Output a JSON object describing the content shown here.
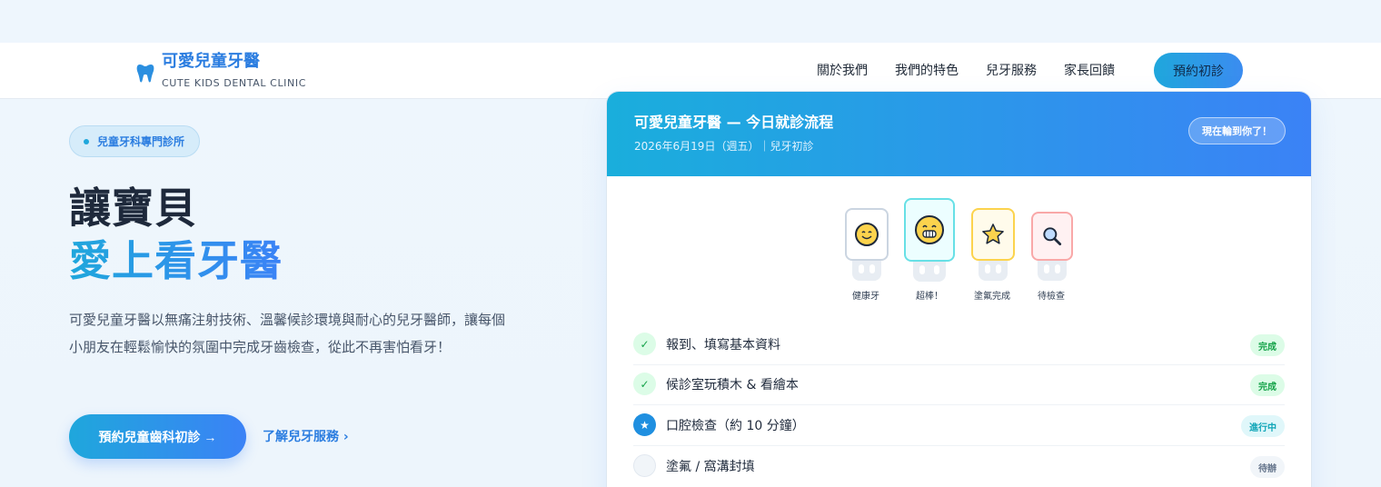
{
  "brand": {
    "title": "可愛兒童牙醫",
    "subtitle": "CUTE KIDS DENTAL CLINIC"
  },
  "nav": {
    "items": [
      "關於我們",
      "我們的特色",
      "兒牙服務",
      "家長回饋"
    ],
    "cta": "預約初診"
  },
  "hero": {
    "badge": "兒童牙科專門診所",
    "title_line1": "讓寶貝",
    "title_line2": "愛上看牙醫",
    "description": "可愛兒童牙醫以無痛注射技術、溫馨候診環境與耐心的兒牙醫師，讓每個小朋友在輕鬆愉快的氛圍中完成牙齒檢查，從此不再害怕看牙！",
    "cta_primary": "預約兒童齒科初診 →",
    "cta_secondary": "了解兒牙服務 ›"
  },
  "card": {
    "title": "可愛兒童牙醫 — 今日就診流程",
    "subtitle": "2026年6月19日（週五）｜兒牙初診",
    "pill": "現在輪到你了！",
    "teeth": [
      {
        "label": "健康牙",
        "icon": "smile-face-icon",
        "border": "#cbd5e1"
      },
      {
        "label": "超棒！",
        "icon": "grin-face-icon",
        "border": "#67e0e6"
      },
      {
        "label": "塗氟完成",
        "icon": "star-icon",
        "border": "#fcd34d"
      },
      {
        "label": "待檢查",
        "icon": "magnifier-icon",
        "border": "#f9a8a8"
      }
    ],
    "steps": [
      {
        "text": "報到、填寫基本資料",
        "status": "完成"
      },
      {
        "text": "候診室玩積木 & 看繪本",
        "status": "完成"
      },
      {
        "text": "口腔檢查（約 10 分鐘）",
        "status": "進行中"
      },
      {
        "text": "塗氟 / 窩溝封填",
        "status": "待辦"
      }
    ]
  },
  "colors": {
    "accent": "#2b7de0",
    "accent_cyan": "#1fa7dc",
    "done": "#16a34a",
    "progress": "#0ea5b7"
  }
}
